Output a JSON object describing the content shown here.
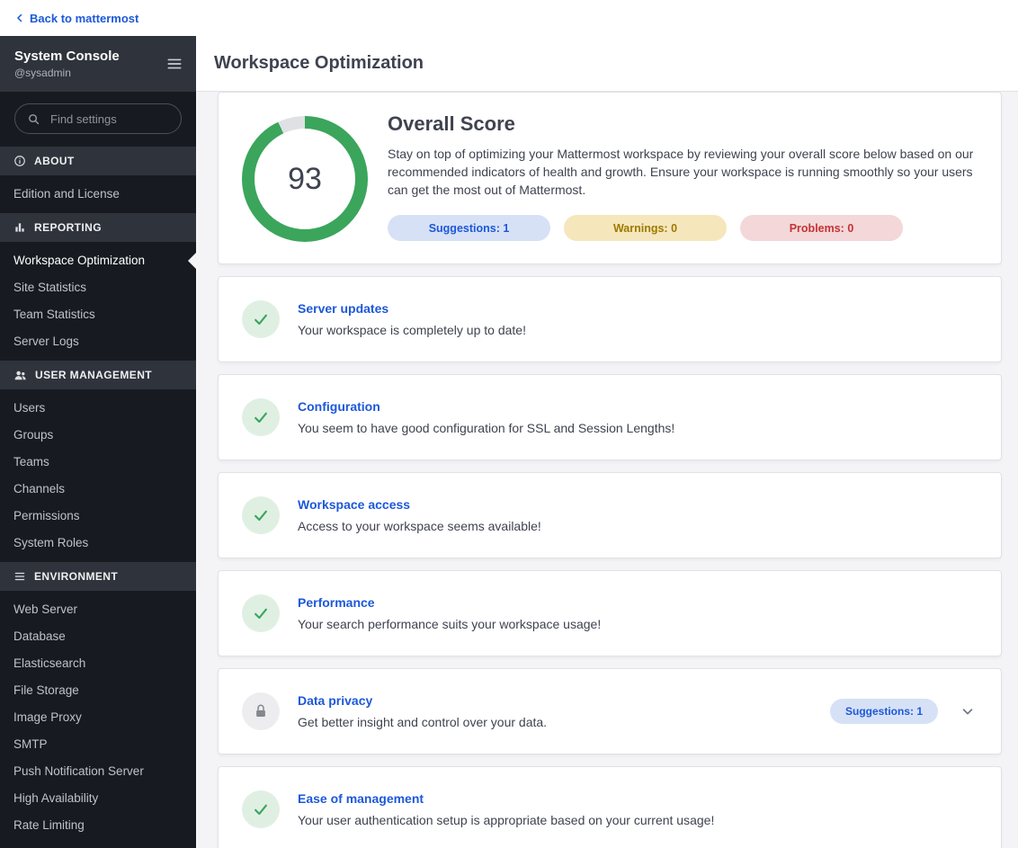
{
  "topbar": {
    "back_label": "Back to mattermost"
  },
  "sidebar": {
    "title": "System Console",
    "subtitle": "@sysadmin",
    "search_placeholder": "Find settings",
    "sections": [
      {
        "label": "ABOUT",
        "icon": "info-icon",
        "items": [
          {
            "label": "Edition and License",
            "active": false
          }
        ]
      },
      {
        "label": "REPORTING",
        "icon": "bar-chart-icon",
        "items": [
          {
            "label": "Workspace Optimization",
            "active": true
          },
          {
            "label": "Site Statistics",
            "active": false
          },
          {
            "label": "Team Statistics",
            "active": false
          },
          {
            "label": "Server Logs",
            "active": false
          }
        ]
      },
      {
        "label": "USER MANAGEMENT",
        "icon": "users-icon",
        "items": [
          {
            "label": "Users",
            "active": false
          },
          {
            "label": "Groups",
            "active": false
          },
          {
            "label": "Teams",
            "active": false
          },
          {
            "label": "Channels",
            "active": false
          },
          {
            "label": "Permissions",
            "active": false
          },
          {
            "label": "System Roles",
            "active": false
          }
        ]
      },
      {
        "label": "ENVIRONMENT",
        "icon": "environment-icon",
        "items": [
          {
            "label": "Web Server",
            "active": false
          },
          {
            "label": "Database",
            "active": false
          },
          {
            "label": "Elasticsearch",
            "active": false
          },
          {
            "label": "File Storage",
            "active": false
          },
          {
            "label": "Image Proxy",
            "active": false
          },
          {
            "label": "SMTP",
            "active": false
          },
          {
            "label": "Push Notification Server",
            "active": false
          },
          {
            "label": "High Availability",
            "active": false
          },
          {
            "label": "Rate Limiting",
            "active": false
          }
        ]
      }
    ]
  },
  "header": {
    "title": "Workspace Optimization"
  },
  "overview": {
    "score": "93",
    "score_percent": 93,
    "title": "Overall Score",
    "description": "Stay on top of optimizing your Mattermost workspace by reviewing your overall score below based on our recommended indicators of health and growth. Ensure your workspace is running smoothly so your users can get the most out of Mattermost.",
    "chips": [
      {
        "label": "Suggestions: 1",
        "type": "suggestions"
      },
      {
        "label": "Warnings: 0",
        "type": "warnings"
      },
      {
        "label": "Problems: 0",
        "type": "problems"
      }
    ]
  },
  "cards": [
    {
      "title": "Server updates",
      "description": "Your workspace is completely up to date!",
      "icon": "check-icon"
    },
    {
      "title": "Configuration",
      "description": "You seem to have good configuration for SSL and Session Lengths!",
      "icon": "check-icon"
    },
    {
      "title": "Workspace access",
      "description": "Access to your workspace seems available!",
      "icon": "check-icon"
    },
    {
      "title": "Performance",
      "description": "Your search performance suits your workspace usage!",
      "icon": "check-icon"
    },
    {
      "title": "Data privacy",
      "description": "Get better insight and control over your data.",
      "icon": "lock-icon",
      "chip": {
        "label": "Suggestions: 1",
        "type": "suggestions"
      },
      "expandable": true
    },
    {
      "title": "Ease of management",
      "description": "Your user authentication setup is appropriate based on your current usage!",
      "icon": "check-icon"
    }
  ],
  "colors": {
    "accent_blue": "#1c58d9",
    "success_green": "#3ba55c",
    "warning_amber": "#9d7a00",
    "danger_red": "#c43333",
    "sidebar_bg": "#171b21",
    "content_bg": "#f4f4f6"
  }
}
